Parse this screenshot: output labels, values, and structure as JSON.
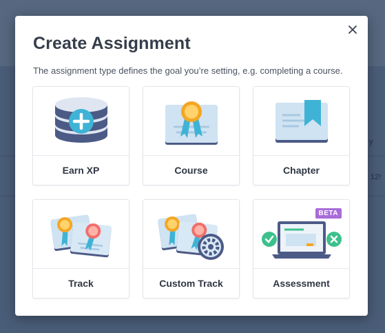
{
  "background": {
    "right_text_1": "y",
    "right_text_2": "12!"
  },
  "modal": {
    "title": "Create Assignment",
    "subtitle": "The assignment type defines the goal you’re setting, e.g. completing a course.",
    "close_icon": "close-icon"
  },
  "cards": [
    {
      "label": "Earn XP",
      "icon": "xp-coins-plus-icon"
    },
    {
      "label": "Course",
      "icon": "course-certificate-icon"
    },
    {
      "label": "Chapter",
      "icon": "chapter-book-icon"
    },
    {
      "label": "Track",
      "icon": "track-certificates-icon"
    },
    {
      "label": "Custom Track",
      "icon": "custom-track-gear-icon"
    },
    {
      "label": "Assessment",
      "icon": "assessment-laptop-icon",
      "badge": "BETA"
    }
  ],
  "colors": {
    "accent_blue": "#3fb3d6",
    "ribbon_orange": "#f5a623",
    "beta_purple": "#a96bd8",
    "check_green": "#3ec08c"
  }
}
